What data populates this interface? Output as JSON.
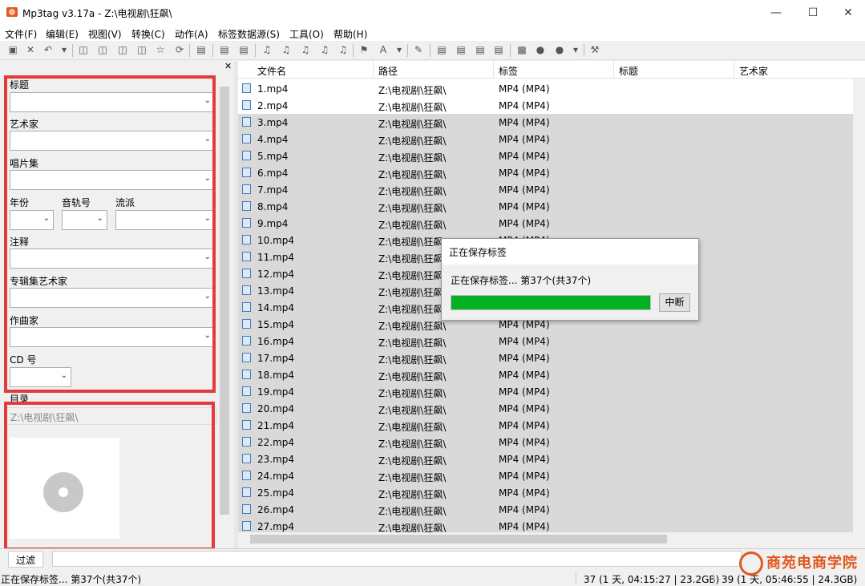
{
  "window": {
    "title": "Mp3tag v3.17a  -  Z:\\电视剧\\狂飙\\"
  },
  "menu": [
    "文件(F)",
    "编辑(E)",
    "视图(V)",
    "转换(C)",
    "动作(A)",
    "标签数据源(S)",
    "工具(O)",
    "帮助(H)"
  ],
  "left_panel": {
    "fields": {
      "title": "标题",
      "artist": "艺术家",
      "album": "唱片集",
      "year": "年份",
      "track": "音轨号",
      "genre": "流派",
      "comment": "注释",
      "album_artist": "专辑集艺术家",
      "composer": "作曲家",
      "cd": "CD 号",
      "directory": "目录"
    },
    "directory_value": "Z:\\电视剧\\狂飙\\"
  },
  "list": {
    "columns": [
      "文件名",
      "路径",
      "标签",
      "标题",
      "艺术家"
    ],
    "rows": [
      {
        "file": "1.mp4",
        "path": "Z:\\电视剧\\狂飙\\",
        "tag": "MP4 (MP4)"
      },
      {
        "file": "2.mp4",
        "path": "Z:\\电视剧\\狂飙\\",
        "tag": "MP4 (MP4)"
      },
      {
        "file": "3.mp4",
        "path": "Z:\\电视剧\\狂飙\\",
        "tag": "MP4 (MP4)"
      },
      {
        "file": "4.mp4",
        "path": "Z:\\电视剧\\狂飙\\",
        "tag": "MP4 (MP4)"
      },
      {
        "file": "5.mp4",
        "path": "Z:\\电视剧\\狂飙\\",
        "tag": "MP4 (MP4)"
      },
      {
        "file": "6.mp4",
        "path": "Z:\\电视剧\\狂飙\\",
        "tag": "MP4 (MP4)"
      },
      {
        "file": "7.mp4",
        "path": "Z:\\电视剧\\狂飙\\",
        "tag": "MP4 (MP4)"
      },
      {
        "file": "8.mp4",
        "path": "Z:\\电视剧\\狂飙\\",
        "tag": "MP4 (MP4)"
      },
      {
        "file": "9.mp4",
        "path": "Z:\\电视剧\\狂飙\\",
        "tag": "MP4 (MP4)"
      },
      {
        "file": "10.mp4",
        "path": "Z:\\电视剧\\狂飙\\",
        "tag": "MP4 (MP4)"
      },
      {
        "file": "11.mp4",
        "path": "Z:\\电视剧\\狂飙\\",
        "tag": "MP4 (MP4)"
      },
      {
        "file": "12.mp4",
        "path": "Z:\\电视剧\\狂飙\\",
        "tag": "MP4 (MP4)"
      },
      {
        "file": "13.mp4",
        "path": "Z:\\电视剧\\狂飙\\",
        "tag": "MP4 (MP4)"
      },
      {
        "file": "14.mp4",
        "path": "Z:\\电视剧\\狂飙\\",
        "tag": "MP4 (MP4)"
      },
      {
        "file": "15.mp4",
        "path": "Z:\\电视剧\\狂飙\\",
        "tag": "MP4 (MP4)"
      },
      {
        "file": "16.mp4",
        "path": "Z:\\电视剧\\狂飙\\",
        "tag": "MP4 (MP4)"
      },
      {
        "file": "17.mp4",
        "path": "Z:\\电视剧\\狂飙\\",
        "tag": "MP4 (MP4)"
      },
      {
        "file": "18.mp4",
        "path": "Z:\\电视剧\\狂飙\\",
        "tag": "MP4 (MP4)"
      },
      {
        "file": "19.mp4",
        "path": "Z:\\电视剧\\狂飙\\",
        "tag": "MP4 (MP4)"
      },
      {
        "file": "20.mp4",
        "path": "Z:\\电视剧\\狂飙\\",
        "tag": "MP4 (MP4)"
      },
      {
        "file": "21.mp4",
        "path": "Z:\\电视剧\\狂飙\\",
        "tag": "MP4 (MP4)"
      },
      {
        "file": "22.mp4",
        "path": "Z:\\电视剧\\狂飙\\",
        "tag": "MP4 (MP4)"
      },
      {
        "file": "23.mp4",
        "path": "Z:\\电视剧\\狂飙\\",
        "tag": "MP4 (MP4)"
      },
      {
        "file": "24.mp4",
        "path": "Z:\\电视剧\\狂飙\\",
        "tag": "MP4 (MP4)"
      },
      {
        "file": "25.mp4",
        "path": "Z:\\电视剧\\狂飙\\",
        "tag": "MP4 (MP4)"
      },
      {
        "file": "26.mp4",
        "path": "Z:\\电视剧\\狂飙\\",
        "tag": "MP4 (MP4)"
      },
      {
        "file": "27.mp4",
        "path": "Z:\\电视剧\\狂飙\\",
        "tag": "MP4 (MP4)"
      }
    ]
  },
  "dialog": {
    "title": "正在保存标签",
    "message": "正在保存标签... 第37个(共37个)",
    "progress": 1.0,
    "button": "中断"
  },
  "filter": {
    "tab_label": "过滤"
  },
  "status": {
    "left": "正在保存标签... 第37个(共37个)",
    "selected": "37 (1 天, 04:15:27 | 23.2GB)",
    "total": "39 (1 天, 05:46:55 | 24.3GB)"
  },
  "logo": {
    "text": "商苑电商学院"
  },
  "colors": {
    "progress": "#06b025",
    "highlight": "#e53a3a",
    "selection": "#d9d9d9"
  }
}
